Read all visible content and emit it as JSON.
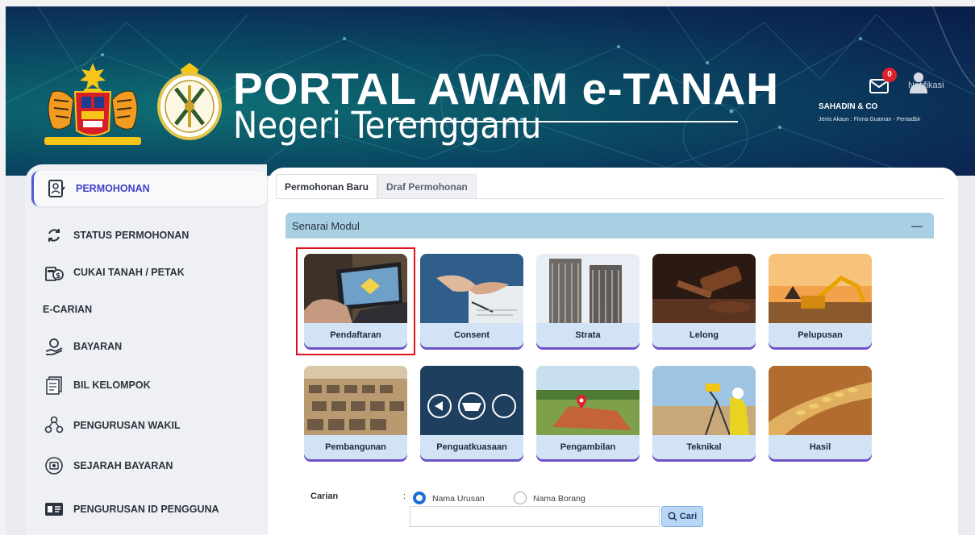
{
  "header": {
    "title": "PORTAL AWAM e-TANAH",
    "subtitle": "Negeri Terengganu",
    "notification_count": "0",
    "notification_label": "Notifikasi",
    "company": "SAHADIN & CO",
    "account_type": "Jenis Akaun : Firma Guaman - Pentadbir"
  },
  "sidebar": {
    "items": [
      {
        "label": "PERMOHONAN",
        "icon": "application-form-icon",
        "active": true
      },
      {
        "label": "STATUS PERMOHONAN",
        "icon": "refresh-icon",
        "active": false
      },
      {
        "label": "CUKAI TANAH / PETAK",
        "icon": "tax-money-icon",
        "active": false
      },
      {
        "label": "E-CARIAN",
        "icon": "",
        "active": false
      },
      {
        "label": "BAYARAN",
        "icon": "payment-hand-icon",
        "active": false
      },
      {
        "label": "BIL KELOMPOK",
        "icon": "batch-bill-icon",
        "active": false
      },
      {
        "label": "PENGURUSAN WAKIL",
        "icon": "people-network-icon",
        "active": false
      },
      {
        "label": "SEJARAH BAYARAN",
        "icon": "payment-history-icon",
        "active": false
      },
      {
        "label": "PENGURUSAN ID PENGGUNA",
        "icon": "id-card-icon",
        "active": false
      }
    ]
  },
  "tabs": [
    {
      "label": "Permohonan Baru",
      "active": true
    },
    {
      "label": "Draf Permohonan",
      "active": false
    }
  ],
  "module_panel": {
    "title": "Senarai Modul",
    "collapse_symbol": "—"
  },
  "modules": [
    {
      "label": "Pendaftaran",
      "selected": true
    },
    {
      "label": "Consent",
      "selected": false
    },
    {
      "label": "Strata",
      "selected": false
    },
    {
      "label": "Lelong",
      "selected": false
    },
    {
      "label": "Pelupusan",
      "selected": false
    },
    {
      "label": "Pembangunan",
      "selected": false
    },
    {
      "label": "Penguatkuasaan",
      "selected": false
    },
    {
      "label": "Pengambilan",
      "selected": false
    },
    {
      "label": "Teknikal",
      "selected": false
    },
    {
      "label": "Hasil",
      "selected": false
    }
  ],
  "search": {
    "label": "Carian",
    "colon": ":",
    "option_1": "Nama Urusan",
    "option_2": "Nama Borang",
    "selected_option": "Nama Urusan",
    "input_value": "",
    "button_label": "Cari"
  },
  "colors": {
    "accent": "#4a5cdb",
    "module_bar": "#a9cfe3",
    "card_underline": "#6b53c9",
    "highlight": "#e0101a"
  }
}
